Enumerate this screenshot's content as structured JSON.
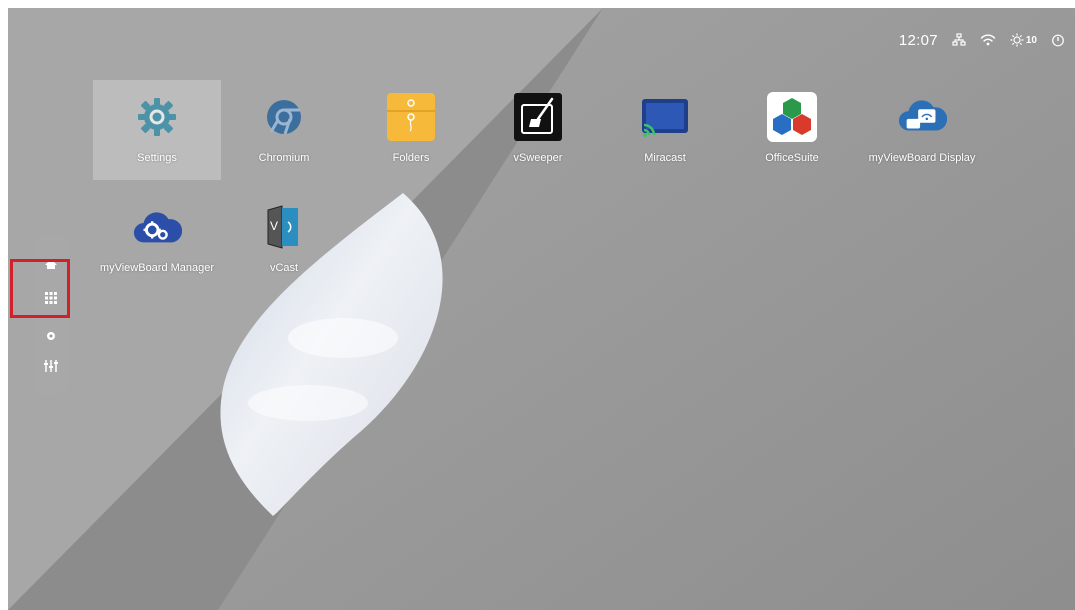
{
  "status_bar": {
    "time": "12:07",
    "icons": [
      "network-icon",
      "wifi-icon",
      "brightness-icon",
      "power-icon"
    ],
    "brightness_level": "10"
  },
  "apps": [
    {
      "label": "Settings",
      "icon": "gear-icon",
      "selected": true
    },
    {
      "label": "Chromium",
      "icon": "chromium-icon"
    },
    {
      "label": "Folders",
      "icon": "folder-icon"
    },
    {
      "label": "vSweeper",
      "icon": "vsweeper-icon"
    },
    {
      "label": "Miracast",
      "icon": "miracast-icon"
    },
    {
      "label": "OfficeSuite",
      "icon": "officesuite-icon"
    },
    {
      "label": "myViewBoard Display",
      "icon": "myviewboard-display-icon"
    },
    {
      "label": "myViewBoard Manager",
      "icon": "myviewboard-manager-icon"
    },
    {
      "label": "vCast",
      "icon": "vcast-icon"
    }
  ],
  "sidebar": {
    "buttons": [
      "home-icon",
      "apps-grid-icon",
      "settings-icon",
      "equalizer-icon"
    ],
    "highlighted": "apps-grid-icon"
  },
  "colors": {
    "highlight_border": "#d0202a",
    "folder_yellow": "#f6b93a",
    "app_blue": "#2b6fb6"
  }
}
